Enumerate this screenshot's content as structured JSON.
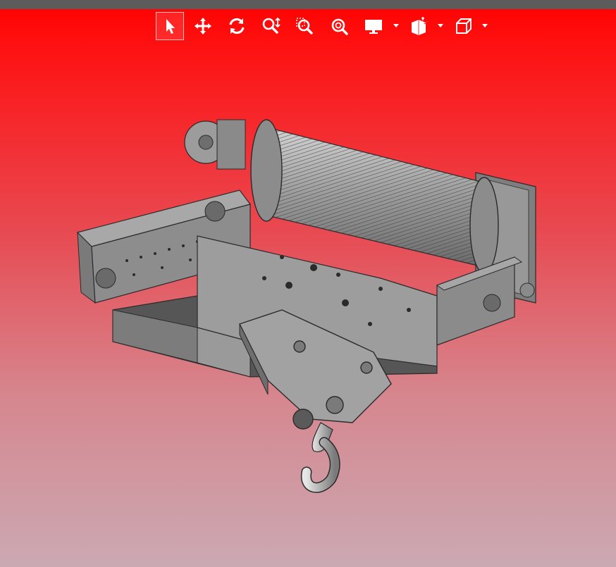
{
  "app": {
    "background_top_color": "#ff0000",
    "background_bottom_color": "#cba9b3"
  },
  "toolbar": {
    "tools": [
      {
        "id": "select",
        "icon": "select-arrow-icon",
        "active": true
      },
      {
        "id": "pan",
        "icon": "pan-move-icon",
        "active": false
      },
      {
        "id": "rotate",
        "icon": "rotate-icon",
        "active": false
      },
      {
        "id": "zoom",
        "icon": "zoom-icon",
        "active": false
      },
      {
        "id": "zoom-window",
        "icon": "zoom-window-icon",
        "active": false
      },
      {
        "id": "zoom-fit",
        "icon": "zoom-fit-icon",
        "active": false
      },
      {
        "id": "display",
        "icon": "display-monitor-icon",
        "active": false,
        "dropdown": true
      },
      {
        "id": "section",
        "icon": "section-plane-icon",
        "active": false,
        "dropdown": true
      },
      {
        "id": "view-cube",
        "icon": "view-cube-icon",
        "active": false,
        "dropdown": true
      }
    ]
  },
  "model": {
    "subject": "hoist-trolley-3d-model",
    "part_color": "#8f8f8f",
    "edge_color": "#2a2a2a"
  }
}
